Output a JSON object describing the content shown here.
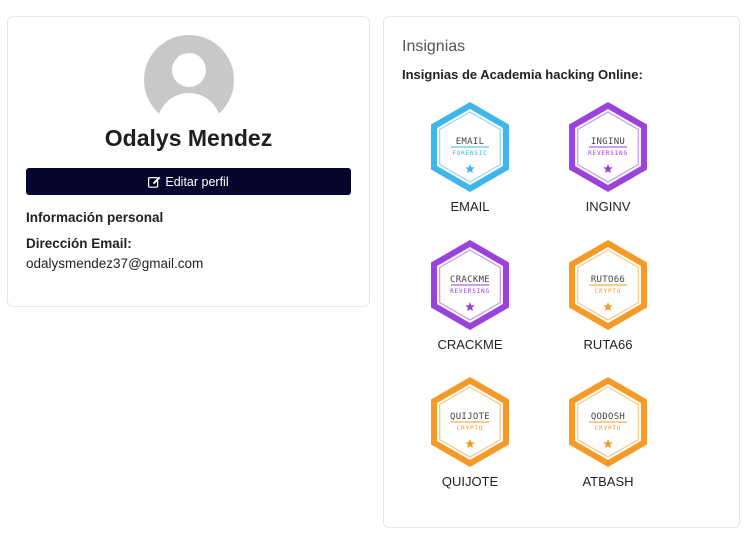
{
  "profile": {
    "name": "Odalys Mendez",
    "edit_button_label": "Editar perfil",
    "personal_info_heading": "Información personal",
    "email_label": "Dirección Email:",
    "email_value": "odalysmendez37@gmail.com"
  },
  "badges": {
    "title": "Insignias",
    "subtitle": "Insignias de Academia hacking Online:",
    "items": [
      {
        "label": "EMAIL",
        "emblem_title": "EMAIL",
        "emblem_category": "FORENSIC",
        "color": "#3fb6ea"
      },
      {
        "label": "INGINV",
        "emblem_title": "INGINU",
        "emblem_category": "REVERSING",
        "color": "#9a42dc"
      },
      {
        "label": "CRACKME",
        "emblem_title": "CRACKME",
        "emblem_category": "REVERSING",
        "color": "#9a42dc"
      },
      {
        "label": "RUTA66",
        "emblem_title": "RUTO66",
        "emblem_category": "CRYPTO",
        "color": "#f59a26"
      },
      {
        "label": "QUIJOTE",
        "emblem_title": "QUIJOTE",
        "emblem_category": "CRYPTO",
        "color": "#f59a26"
      },
      {
        "label": "ATBASH",
        "emblem_title": "QODOSH",
        "emblem_category": "CRYPTO",
        "color": "#f59a26"
      }
    ]
  },
  "colors": {
    "button_bg": "#05052d",
    "avatar_bg": "#c8c8c8"
  }
}
